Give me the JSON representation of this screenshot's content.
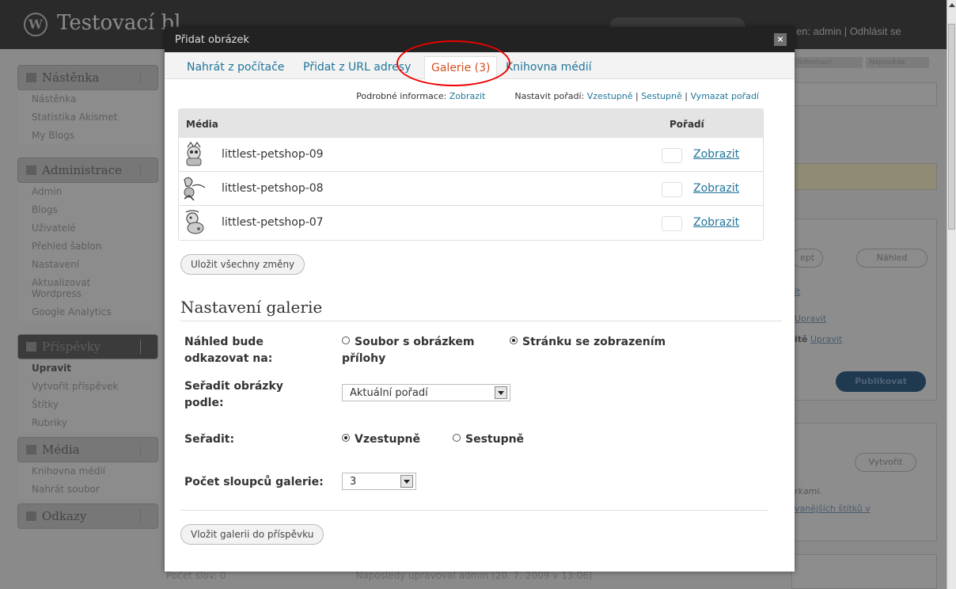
{
  "background": {
    "site_title": "Testovací bl",
    "user_text": "en: admin | Odhlásit se",
    "menus": [
      {
        "title": "Nástěnka",
        "items": [
          "Nástěnka",
          "Statistika Akismet",
          "My Blogs"
        ]
      },
      {
        "title": "Administrace",
        "items": [
          "Admin",
          "Blogs",
          "Uživatelé",
          "Přehled šablon",
          "Nastavení",
          "Aktualizovat",
          "Wordpress",
          "Google Analytics"
        ]
      },
      {
        "title": "Příspěvky",
        "items": [
          "Upravit",
          "Vytvořit příspěvek",
          "Štítky",
          "Rubriky"
        ]
      },
      {
        "title": "Média",
        "items": [
          "Knihovna médií",
          "Nahrát soubor"
        ]
      },
      {
        "title": "Odkazy",
        "items": []
      }
    ],
    "right": {
      "info_tab": "Informací",
      "help_tab": "Nápověda",
      "draft_button": "ept",
      "preview_button": "Náhled",
      "link1": "it",
      "link2": "Upravit",
      "link3_prefix": "itě",
      "link3": "Upravit",
      "publish_button": "Publikovat",
      "create_button": "Vytvořit",
      "hint1": "rkami.",
      "hint2": "vanějších štítků v"
    },
    "footer_words": "Počet slov: 0",
    "footer_edit": "Naposledy upravoval admin (20. 7. 2009 v 13:06)"
  },
  "modal": {
    "title": "Přidat obrázek",
    "close": "×",
    "tabs": [
      {
        "label": "Nahrát z počítače"
      },
      {
        "label": "Přidat z URL adresy"
      },
      {
        "label": "Galerie (3)"
      },
      {
        "label": "Knihovna médií"
      }
    ],
    "details_label": "Podrobné informace:",
    "details_show": "Zobrazit",
    "order_label": "Nastavit pořadí:",
    "order_asc": "Vzestupně",
    "order_desc": "Sestupně",
    "order_clear": "Vymazat pořadí",
    "table": {
      "col_media": "Média",
      "col_order": "Pořadí",
      "rows": [
        {
          "name": "littlest-petshop-09",
          "action": "Zobrazit"
        },
        {
          "name": "littlest-petshop-08",
          "action": "Zobrazit"
        },
        {
          "name": "littlest-petshop-07",
          "action": "Zobrazit"
        }
      ]
    },
    "save_all": "Uložit všechny změny",
    "gallery_settings": {
      "title": "Nastavení galerie",
      "link_label": "Náhled bude odkazovat na:",
      "link_opt1": "Soubor s obrázkem",
      "link_opt2": "Stránku se zobrazením",
      "link_opt2_cont": "přílohy",
      "sort_label": "Seřadit obrázky podle:",
      "sort_value": "Aktuální pořadí",
      "dir_label": "Seřadit:",
      "dir_opt1": "Vzestupně",
      "dir_opt2": "Sestupně",
      "cols_label": "Počet sloupců galerie:",
      "cols_value": "3"
    },
    "insert_gallery": "Vložit galerii do příspěvku"
  }
}
